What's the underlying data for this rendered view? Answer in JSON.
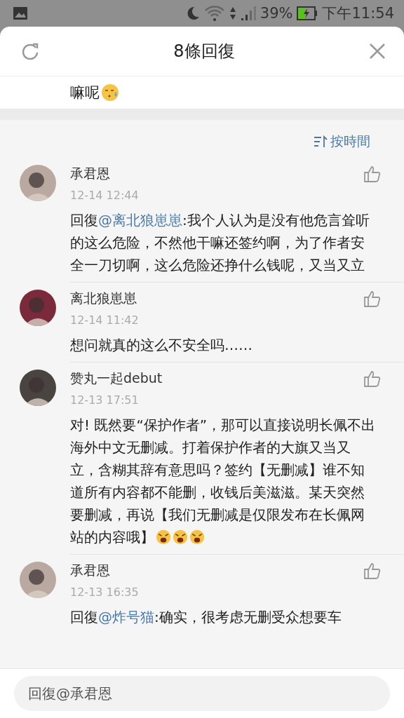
{
  "status_bar": {
    "battery": "39%",
    "time": "下午11:54"
  },
  "header": {
    "title": "8條回復"
  },
  "previous_text": "嘛呢",
  "sort": {
    "label": "按時間"
  },
  "comments": [
    {
      "user": "承君恩",
      "time": "12-14 12:44",
      "reply_prefix": "回復",
      "mention": "@离北狼崽崽",
      "text": ":我个人认为是没有他危言耸听的这么危险，不然他干嘛还签约啊，为了作者安全一刀切啊，这么危险还挣什么钱呢，又当又立"
    },
    {
      "user": "离北狼崽崽",
      "time": "12-14 11:42",
      "text": "想问就真的这么不安全吗……"
    },
    {
      "user": "赞丸一起debut",
      "time": "12-13 17:51",
      "text": "对! 既然要“保护作者”，那可以直接说明长佩不出海外中文无删减。打着保护作者的大旗又当又立，含糊其辞有意思吗？签约【无删减】谁不知道所有内容都不能删，收钱后美滋滋。某天突然要删减，再说【我们无删减是仅限发布在长佩网站的内容哦】",
      "emojis": [
        {
          "kind": "angry"
        },
        {
          "kind": "angry"
        },
        {
          "kind": "angry"
        }
      ]
    },
    {
      "user": "承君恩",
      "time": "12-13 16:35",
      "reply_prefix": "回復",
      "mention": "@炸号猫",
      "text": ":确实，很考虑无删受众想要车"
    }
  ],
  "reply_field": {
    "placeholder": "回復@承君恩"
  }
}
